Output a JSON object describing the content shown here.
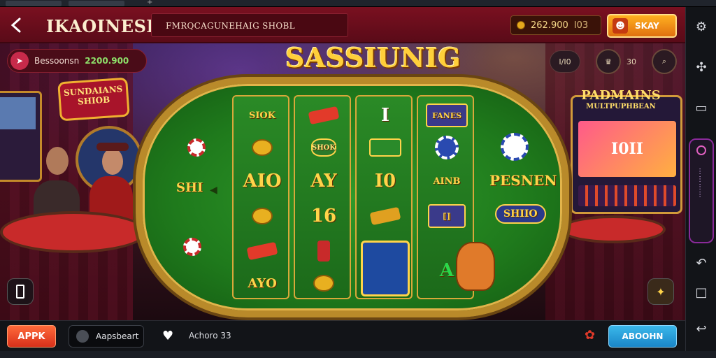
{
  "header": {
    "app_title": "IKAOINESIA",
    "tagline": "FMRQCAGUNEHAIG SHOBL",
    "balance_value": "262.900",
    "balance_unit": "I03",
    "spin_label": "SKAY"
  },
  "status": {
    "chip_label": "Bessoonsn",
    "chip_value": "2200.900",
    "mini_left": "I/I0",
    "mini_right": "30"
  },
  "scene": {
    "left_sign_line1": "SUNDAIANS",
    "left_sign_line2": "SHIOB",
    "right_sign_line1": "PADMAINS",
    "right_sign_line2": "MULTPUPHBEAN",
    "right_machine_value": "I0II"
  },
  "game": {
    "title": "SASSIUNIG",
    "left_symbols": [
      "SHI"
    ],
    "right_symbols": [
      "PESNEN",
      "SHIIO"
    ],
    "reels": [
      {
        "symbols": [
          "SIOK",
          "",
          "AIO",
          "",
          "",
          "AYO"
        ]
      },
      {
        "symbols": [
          "",
          "SHOK",
          "AY",
          "16",
          "",
          ""
        ]
      },
      {
        "symbols": [
          "I",
          "",
          "I0",
          "",
          "",
          ""
        ]
      },
      {
        "symbols": [
          "FANES",
          "",
          "AINB",
          "",
          "",
          "A"
        ]
      }
    ]
  },
  "bottombar": {
    "apk_label": "APPK",
    "search_label": "Aapsbeart",
    "action_label": "Achoro 33",
    "action_button": "ABOOHN"
  },
  "icons": {
    "back": "back-icon",
    "spin": "spin-icon",
    "settings": "gear-icon",
    "extension": "puzzle-icon",
    "battery": "battery-icon",
    "rotate": "rotate-icon",
    "square": "square-icon",
    "back_nav": "back-nav-icon"
  },
  "colors": {
    "topbar": "#7a1020",
    "board_felt": "#1f7a1c",
    "board_rim": "#b98a2a",
    "title_gold": "#ffcf3a",
    "apk_orange": "#e0401a",
    "action_blue": "#1a86c8"
  }
}
